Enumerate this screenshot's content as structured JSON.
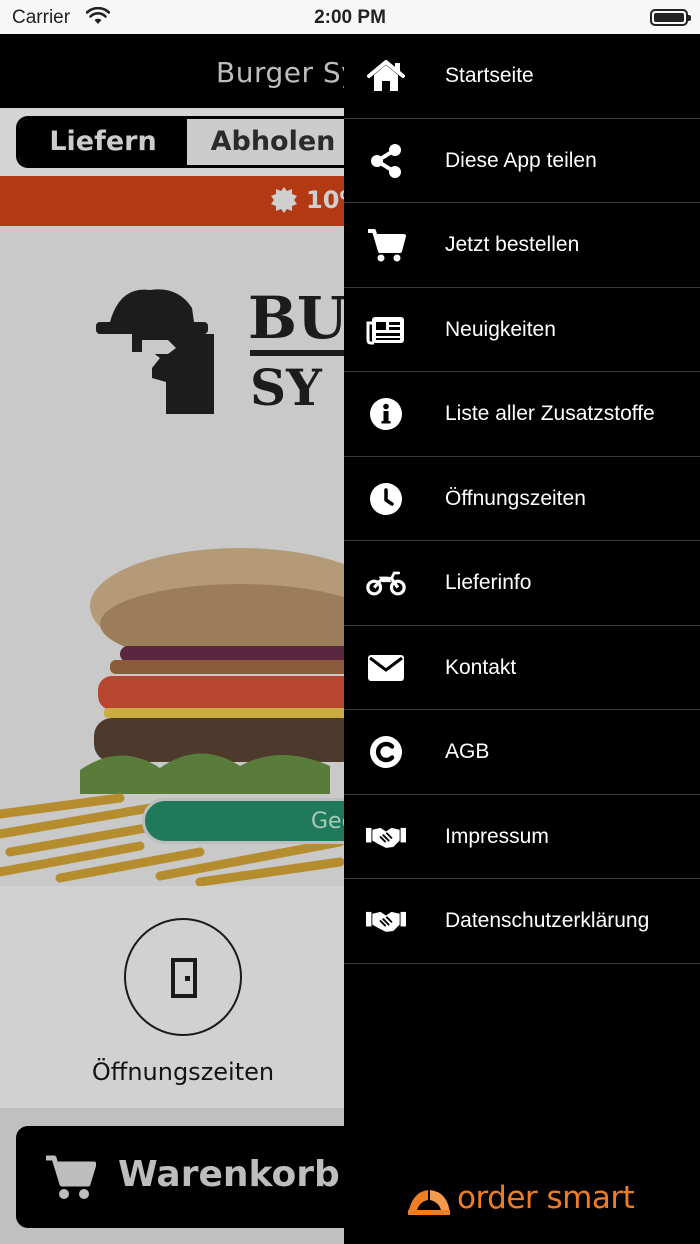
{
  "status_bar": {
    "carrier": "Carrier",
    "time": "2:00 PM"
  },
  "app": {
    "title": "Burger Syn",
    "tabs": {
      "deliver": "Liefern",
      "pickup": "Abholen"
    },
    "promo": "10%",
    "logo": {
      "line1": "BU",
      "line2": "SY"
    },
    "open_status": "Geö",
    "opening_hours_label": "Öffnungszeiten",
    "cart_label": "Warenkorb"
  },
  "drawer": {
    "items": [
      {
        "label": "Startseite",
        "icon": "home-icon"
      },
      {
        "label": "Diese App teilen",
        "icon": "share-icon"
      },
      {
        "label": "Jetzt bestellen",
        "icon": "cart-icon"
      },
      {
        "label": "Neuigkeiten",
        "icon": "newspaper-icon"
      },
      {
        "label": "Liste aller Zusatzstoffe",
        "icon": "info-icon"
      },
      {
        "label": "Öffnungszeiten",
        "icon": "clock-icon"
      },
      {
        "label": "Lieferinfo",
        "icon": "motorcycle-icon"
      },
      {
        "label": "Kontakt",
        "icon": "envelope-icon"
      },
      {
        "label": "AGB",
        "icon": "copyright-icon"
      },
      {
        "label": "Impressum",
        "icon": "handshake-icon"
      },
      {
        "label": "Datenschutzerklärung",
        "icon": "handshake-icon"
      }
    ],
    "brand": "order smart"
  },
  "colors": {
    "accent": "#ef7d22",
    "promo": "#b33915",
    "open": "#1e7a5a"
  }
}
